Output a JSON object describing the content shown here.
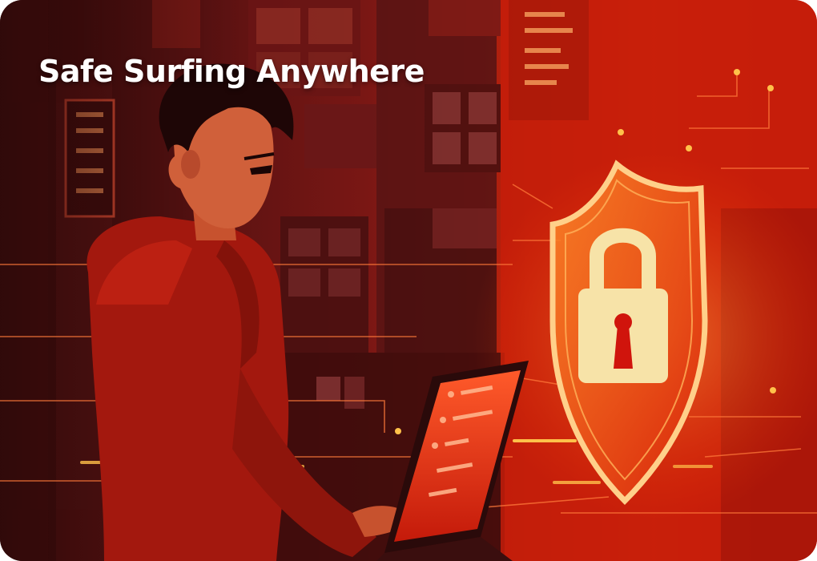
{
  "banner": {
    "title": "Safe Surfing Anywhere"
  },
  "icons": {
    "shield": "shield-icon",
    "lock": "padlock-icon",
    "laptop": "laptop-icon"
  },
  "colors": {
    "title_text": "#ffffff",
    "accent_red": "#e0220a",
    "shield_glow": "#ff9a3c",
    "lock_fill": "#f7e3a8",
    "keyhole": "#d0140c"
  }
}
